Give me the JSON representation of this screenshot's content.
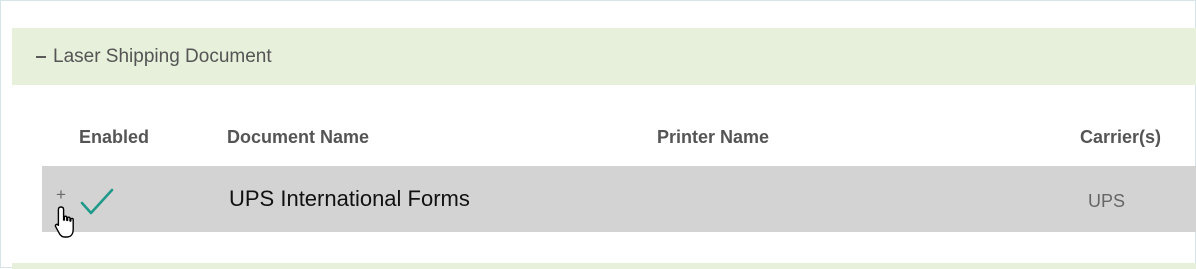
{
  "section": {
    "title": "Laser Shipping Document",
    "toggle_icon": "minus-icon"
  },
  "table": {
    "columns": [
      "Enabled",
      "Document Name",
      "Printer Name",
      "Carrier(s)"
    ],
    "rows": [
      {
        "expand_symbol": "+",
        "enabled": true,
        "enabled_icon": "checkmark-icon",
        "document_name": "UPS International Forms",
        "printer_name": "",
        "carriers": "UPS"
      }
    ]
  },
  "colors": {
    "section_header_bg": "#e7f0db",
    "selected_row_bg": "#d3d3d3",
    "check_color": "#1f9a8a"
  },
  "cursor_icon": "hand-pointer-icon"
}
